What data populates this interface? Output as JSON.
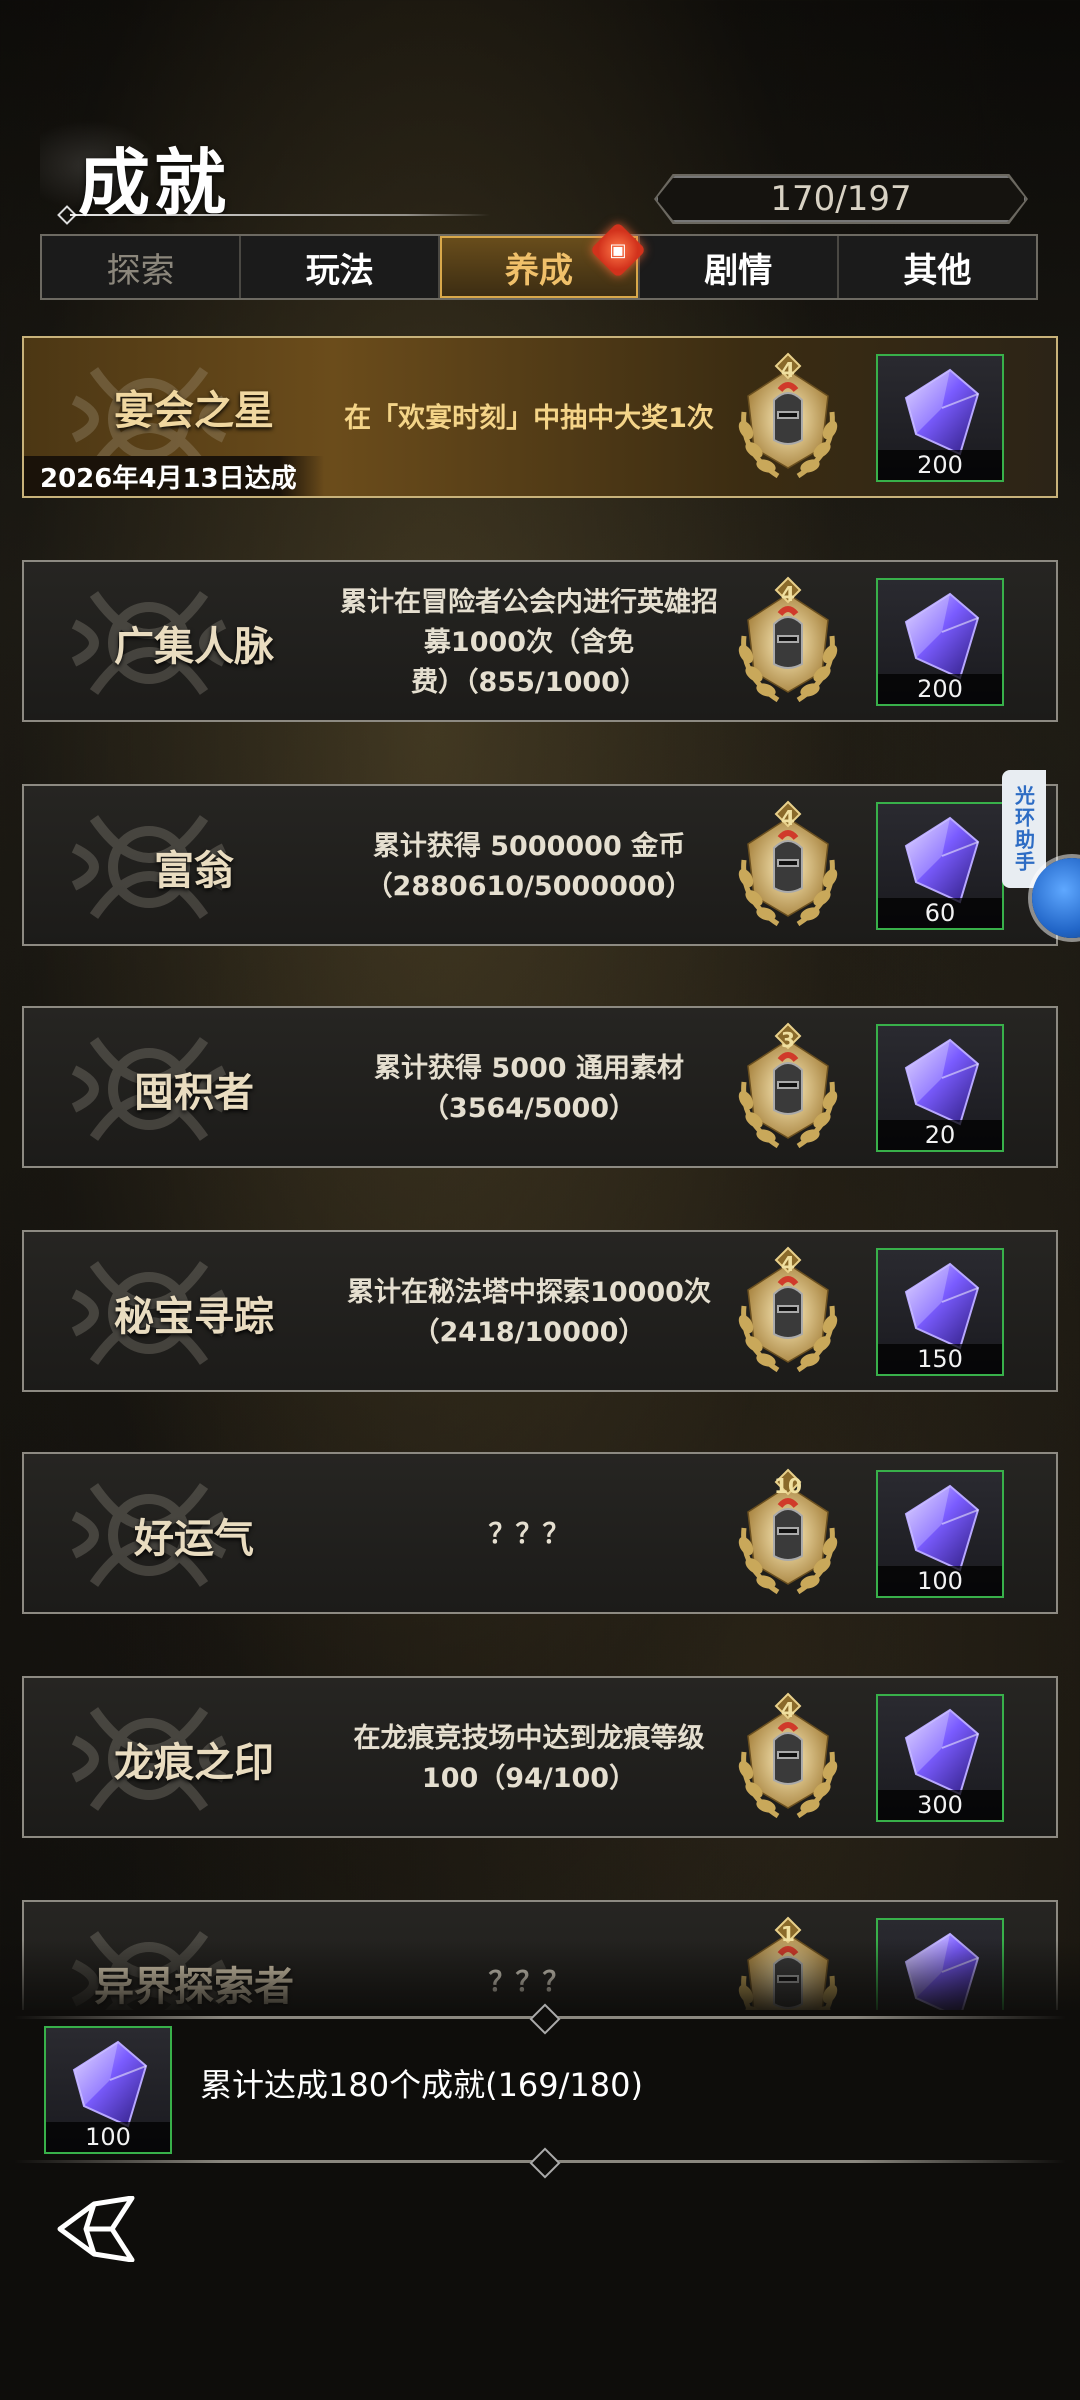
{
  "header": {
    "title": "成就",
    "progress": "170/197"
  },
  "tabs": [
    {
      "label": "探索",
      "state": "dim"
    },
    {
      "label": "玩法",
      "state": "normal"
    },
    {
      "label": "养成",
      "state": "active",
      "badge_icon": "gift-badge-icon"
    },
    {
      "label": "剧情",
      "state": "normal"
    },
    {
      "label": "其他",
      "state": "normal"
    }
  ],
  "achievements": [
    {
      "name": "宴会之星",
      "desc": "在「欢宴时刻」中抽中大奖1次",
      "date": "2026年4月13日达成",
      "badge_level": "4",
      "reward": "200",
      "completed": true
    },
    {
      "name": "广集人脉",
      "desc": "累计在冒险者公会内进行英雄招\n募1000次（含免\n费）（855/1000）",
      "badge_level": "4",
      "reward": "200"
    },
    {
      "name": "富翁",
      "desc": "累计获得 5000000 金币\n（2880610/5000000）",
      "badge_level": "4",
      "reward": "60"
    },
    {
      "name": "囤积者",
      "desc": "累计获得 5000 通用素材\n（3564/5000）",
      "badge_level": "3",
      "reward": "20"
    },
    {
      "name": "秘宝寻踪",
      "desc": "累计在秘法塔中探索10000次\n（2418/10000）",
      "badge_level": "4",
      "reward": "150"
    },
    {
      "name": "好运气",
      "desc": "？？？",
      "badge_level": "10",
      "reward": "100"
    },
    {
      "name": "龙痕之印",
      "desc": "在龙痕竞技场中达到龙痕等级\n100（94/100）",
      "badge_level": "4",
      "reward": "300"
    },
    {
      "name": "异界探索者",
      "desc": "？？？",
      "badge_level": "1",
      "reward": ""
    }
  ],
  "footer": {
    "text": "累计达成180个成就(169/180)",
    "reward": "100"
  },
  "side_helper": {
    "label": "光环助手"
  },
  "colors": {
    "accent_gold": "#f0c06a",
    "reward_border": "#38b04a",
    "crystal": "#7a5cff"
  }
}
